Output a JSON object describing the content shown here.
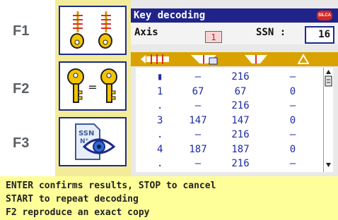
{
  "fkeys": [
    "F1",
    "F2",
    "F3"
  ],
  "title": "Key decoding",
  "axis": {
    "label": "Axis",
    "value": "1"
  },
  "ssn": {
    "label": "SSN :",
    "value": "16"
  },
  "column_icons": [
    "cut-depth-icon",
    "key-profile-icon",
    "key-profile-icon",
    "delta-icon"
  ],
  "rows": [
    [
      "▮",
      "–",
      "216",
      "–"
    ],
    [
      "1",
      "67",
      "67",
      "0"
    ],
    [
      ".",
      "–",
      "216",
      "–"
    ],
    [
      "3",
      "147",
      "147",
      "0"
    ],
    [
      ".",
      "–",
      "216",
      "–"
    ],
    [
      "4",
      "187",
      "187",
      "0"
    ],
    [
      ".",
      "–",
      "216",
      "–"
    ]
  ],
  "messages": [
    "ENTER confirms results, STOP to cancel",
    "START to repeat decoding",
    "F2 reproduce an exact copy"
  ],
  "colors": {
    "title_bg": "#20248a",
    "header_bg": "#d9a200",
    "message_bg": "#ffff99",
    "panel_bg": "#f2ec9a"
  }
}
